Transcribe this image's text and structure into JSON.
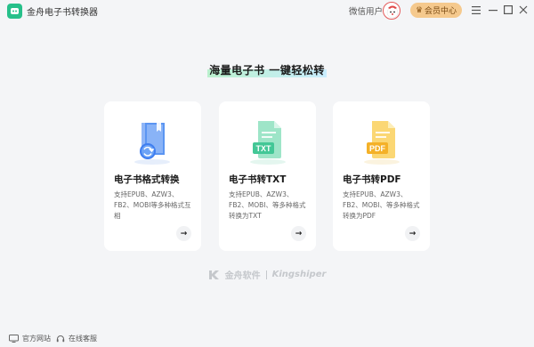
{
  "titlebar": {
    "app_title": "金舟电子书转换器",
    "user_name": "微信用户",
    "vip_label": "会员中心",
    "icons": {
      "logo": "app-logo-icon",
      "vip": "crown-icon",
      "menu": "menu-icon",
      "minimize": "minimize-icon",
      "maximize": "maximize-icon",
      "close": "close-icon"
    }
  },
  "main": {
    "heading": "海量电子书  一键轻松转",
    "cards": [
      {
        "title": "电子书格式转换",
        "desc": "支持EPUB、AZW3、FB2、MOBI等多种格式互相",
        "icon": "book-convert-icon",
        "accent": "#4a8df5"
      },
      {
        "title": "电子书转TXT",
        "desc": "支持EPUB、AZW3、FB2、MOBI、等多种格式转换为TXT",
        "icon": "txt-file-icon",
        "badge": "TXT",
        "accent": "#3fc59a"
      },
      {
        "title": "电子书转PDF",
        "desc": "支持EPUB、AZW3、FB2、MOBI、等多种格式转换为PDF",
        "icon": "pdf-file-icon",
        "badge": "PDF",
        "accent": "#f5b83d"
      }
    ]
  },
  "brand": {
    "cn": "金舟软件",
    "en": "Kingshiper"
  },
  "footer": {
    "website": "官方网站",
    "support": "在线客服"
  }
}
